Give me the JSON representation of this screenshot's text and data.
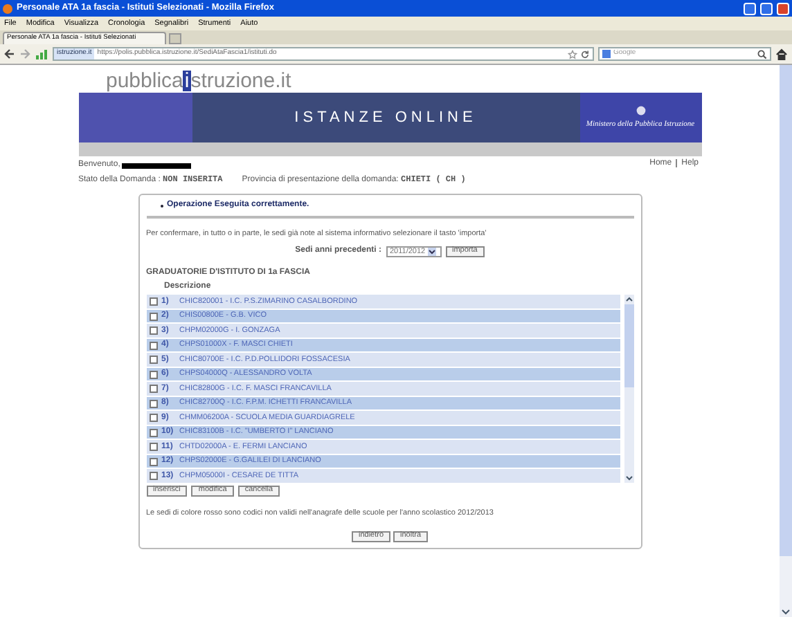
{
  "window": {
    "title": "Personale ATA 1a fascia - Istituti Selezionati - Mozilla Firefox"
  },
  "menu": [
    "File",
    "Modifica",
    "Visualizza",
    "Cronologia",
    "Segnalibri",
    "Strumenti",
    "Aiuto"
  ],
  "tabs": [
    {
      "label": "Personale ATA 1a fascia - Istituti Selezionati",
      "selected": true
    }
  ],
  "address_bar": {
    "site_badge": "istruzione.it",
    "url": "https://polis.pubblica.istruzione.it/SediAtaFascia1/istituti.do"
  },
  "search": {
    "placeholder": "Google"
  },
  "logo": {
    "word": "pubblica",
    "initial": "i",
    "rest": "struzione.it"
  },
  "banner": {
    "title": "ISTANZE ONLINE",
    "ministry": "Ministero della Pubblica Istruzione"
  },
  "user": {
    "greeting": "Benvenuto,",
    "status_label": "Stato della Domanda :",
    "status_value": "NON INSERITA",
    "province_label": "Provincia di presentazione della domanda:",
    "province_value": "CHIETI ( CH )"
  },
  "links": [
    "Home",
    "Help"
  ],
  "message": "Operazione Eseguita correttamente.",
  "instruction": "Per confermare, in tutto o in parte, le sedi già note al sistema informativo selezionare il tasto 'importa'",
  "import": {
    "label": "Sedi anni precedenti :",
    "value": "2011/2012",
    "button": "importa"
  },
  "section_title": "GRADUATORIE D'ISTITUTO DI 1a FASCIA",
  "column": "Descrizione",
  "rows": [
    {
      "number": "1)",
      "text": "CHIC820001 - I.C. P.S.ZIMARINO CASALBORDINO",
      "checked": false
    },
    {
      "number": "2)",
      "text": "CHIS00800E - G.B. VICO",
      "checked": false
    },
    {
      "number": "3)",
      "text": "CHPM02000G - I. GONZAGA",
      "checked": false
    },
    {
      "number": "4)",
      "text": "CHPS01000X - F. MASCI CHIETI",
      "checked": false
    },
    {
      "number": "5)",
      "text": "CHIC80700E - I.C. P.D.POLLIDORI FOSSACESIA",
      "checked": false
    },
    {
      "number": "6)",
      "text": "CHPS04000Q - ALESSANDRO VOLTA",
      "checked": false
    },
    {
      "number": "7)",
      "text": "CHIC82800G - I.C. F. MASCI FRANCAVILLA",
      "checked": false
    },
    {
      "number": "8)",
      "text": "CHIC82700Q - I.C. F.P.M. ICHETTI FRANCAVILLA",
      "checked": false
    },
    {
      "number": "9)",
      "text": "CHMM06200A - SCUOLA MEDIA GUARDIAGRELE",
      "checked": false
    },
    {
      "number": "10)",
      "text": "CHIC83100B - I.C. \"UMBERTO I\" LANCIANO",
      "checked": false
    },
    {
      "number": "11)",
      "text": "CHTD02000A - E. FERMI LANCIANO",
      "checked": false
    },
    {
      "number": "12)",
      "text": "CHPS02000E - G.GALILEI DI LANCIANO",
      "checked": false
    },
    {
      "number": "13)",
      "text": "CHPM05000I - CESARE DE TITTA",
      "checked": false
    }
  ],
  "list_buttons": [
    "inserisci",
    "modifica",
    "cancella"
  ],
  "note": "Le sedi di colore rosso sono codici non validi nell'anagrafe delle scuole per l'anno scolastico 2012/2013",
  "nav_buttons": [
    "indietro",
    "inoltra"
  ]
}
